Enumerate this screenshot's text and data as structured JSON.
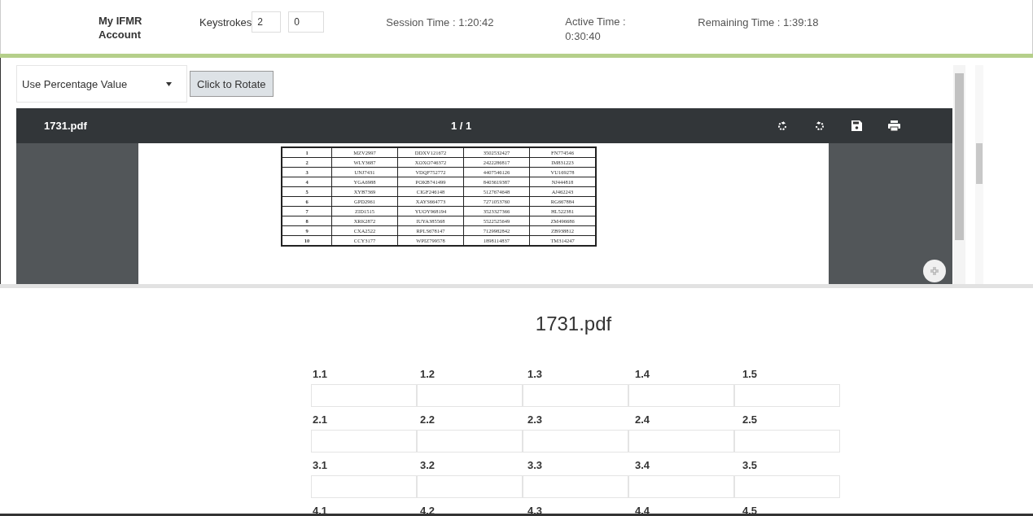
{
  "header": {
    "account": "My IFMR Account",
    "keystrokes_label": "Keystrokes",
    "keystrokes_values": [
      "2",
      "0"
    ],
    "session_time": "Session Time : 1:20:42",
    "active_time": "Active Time : 0:30:40",
    "remaining_time": "Remaining Time : 1:39:18"
  },
  "controls": {
    "select_value": "Use Percentage Value",
    "rotate_button": "Click to Rotate"
  },
  "viewer": {
    "file_name": "1731.pdf",
    "page_indicator": "1 / 1",
    "rows": [
      [
        "1",
        "MZV2997",
        "DDXV121672",
        "3502532427",
        "FN774546"
      ],
      [
        "2",
        "WLY3687",
        "XOXO746372",
        "2422286817",
        "IM831223"
      ],
      [
        "3",
        "UNJ7431",
        "VDQF752772",
        "4407546126",
        "VU169278"
      ],
      [
        "4",
        "YGA6988",
        "POKB741499",
        "8403619387",
        "NJ444818"
      ],
      [
        "5",
        "XYB7369",
        "CIGF246148",
        "5127674648",
        "AJ462243"
      ],
      [
        "6",
        "GPD2961",
        "XAYS664773",
        "7271053760",
        "RG667884"
      ],
      [
        "7",
        "ZID1515",
        "YUOY968194",
        "3523327366",
        "HL522381"
      ],
      [
        "8",
        "XRK2872",
        "IUYA385568",
        "5522525649",
        "ZM496686"
      ],
      [
        "9",
        "CXA2522",
        "RPLS678147",
        "7129982842",
        "ZB938812"
      ],
      [
        "10",
        "CCY3177",
        "WPIZ799578",
        "1898114837",
        "TM314247"
      ]
    ]
  },
  "answer_sheet": {
    "title": "1731.pdf",
    "rows": [
      {
        "labels": [
          "1.1",
          "1.2",
          "1.3",
          "1.4",
          "1.5"
        ],
        "has_inputs": true
      },
      {
        "labels": [
          "2.1",
          "2.2",
          "2.3",
          "2.4",
          "2.5"
        ],
        "has_inputs": true
      },
      {
        "labels": [
          "3.1",
          "3.2",
          "3.3",
          "3.4",
          "3.5"
        ],
        "has_inputs": true
      },
      {
        "labels": [
          "4.1",
          "4.2",
          "4.3",
          "4.4",
          "4.5"
        ],
        "has_inputs": false
      }
    ]
  }
}
